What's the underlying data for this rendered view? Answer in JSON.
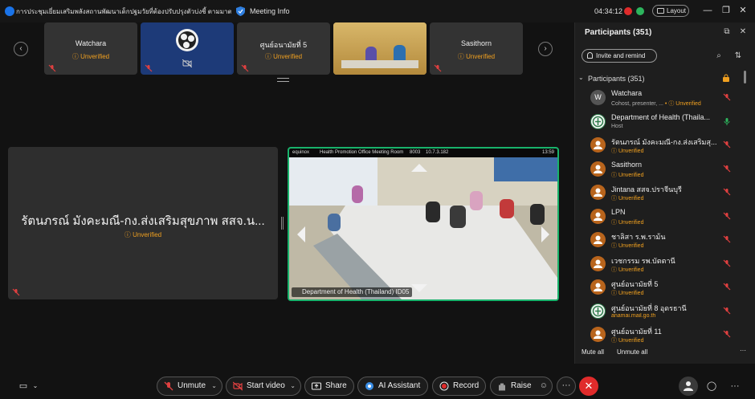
{
  "titlebar": {
    "meeting_title": "การประชุมเยี่ยมเสริมพลังสถานพัฒนาเด็กปฐมวัยที่ต้องปรับปรุงตัวบ่งชี้  ตามมาตรฐา...",
    "meeting_info": "Meeting Info",
    "clock": "04:34:12",
    "layout_label": "Layout"
  },
  "thumbnails": [
    {
      "name": "Watchara",
      "badge": "Unverified"
    },
    {
      "name": "",
      "badge": ""
    },
    {
      "name": "ศูนย์อนามัยที่ 5",
      "badge": "Unverified"
    },
    {
      "name": "",
      "badge": ""
    },
    {
      "name": "Sasithorn",
      "badge": "Unverified"
    }
  ],
  "main": {
    "left_tile_name": "รัตนภรณ์ มังคะมณี-กง.ส่งเสริมสุขภาพ สสจ.น...",
    "left_tile_badge": "Unverified",
    "video_brand": "equinox",
    "video_room": "Health Promotion Office Meeting Room",
    "video_room_id": "8003",
    "video_ip": "10.7.3.182",
    "video_time": "13:59",
    "video_owner": "Department of Health (Thailand) ID05"
  },
  "panel": {
    "title": "Participants (351)",
    "invite_label": "Invite and remind",
    "section_label": "Participants (351)",
    "participants": [
      {
        "initial": "W",
        "name": "Watchara",
        "sub": "Cohost, presenter, ...",
        "badge": "Unverified",
        "avatar": "grey"
      },
      {
        "initial": "",
        "name": "Department of Health (Thaila...",
        "sub": "Host",
        "badge": "",
        "avatar": "logo"
      },
      {
        "initial": "",
        "name": "รัตนภรณ์ มังคะมณี-กง.ส่งเสริมสุ...",
        "sub": "",
        "badge": "Unverified",
        "avatar": "orange"
      },
      {
        "initial": "",
        "name": "Sasithorn",
        "sub": "",
        "badge": "Unverified",
        "avatar": "orange"
      },
      {
        "initial": "",
        "name": "Jintana สสจ.ปราจีนบุรี",
        "sub": "",
        "badge": "Unverified",
        "avatar": "orange"
      },
      {
        "initial": "",
        "name": "LPN",
        "sub": "",
        "badge": "Unverified",
        "avatar": "orange"
      },
      {
        "initial": "",
        "name": "ชาลิสา ร.พ.ราม้น",
        "sub": "",
        "badge": "Unverified",
        "avatar": "orange"
      },
      {
        "initial": "",
        "name": "เวชกรรม รพ.บัตตานี",
        "sub": "",
        "badge": "Unverified",
        "avatar": "orange"
      },
      {
        "initial": "",
        "name": "ศูนย์อนามัยที่ 5",
        "sub": "",
        "badge": "Unverified",
        "avatar": "orange"
      },
      {
        "initial": "",
        "name": "ศูนย์อนามัยที่ 8 อุดรธานี",
        "sub": "anamai.mail.go.th",
        "badge": "",
        "avatar": "logo"
      },
      {
        "initial": "",
        "name": "ศูนย์อนามัยที่ 11",
        "sub": "",
        "badge": "Unverified",
        "avatar": "orange"
      }
    ],
    "mute_all": "Mute all",
    "unmute_all": "Unmute all"
  },
  "toolbar": {
    "unmute": "Unmute",
    "start_video": "Start video",
    "share": "Share",
    "ai_assistant": "AI Assistant",
    "record": "Record",
    "raise": "Raise"
  },
  "colors": {
    "unverified": "#f0a020",
    "active_border": "#18b26b",
    "end_call": "#e02b2b",
    "avatar_orange": "#b8641c"
  }
}
